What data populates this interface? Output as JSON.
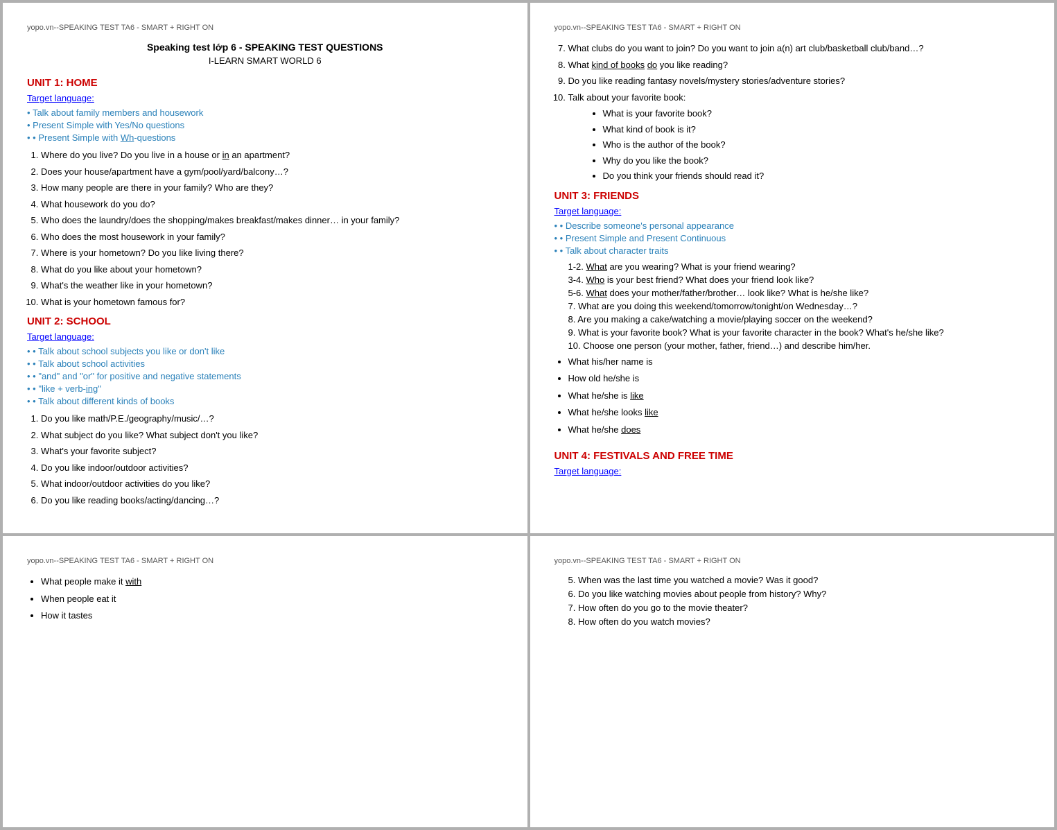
{
  "watermark": "yopo.vn--SPEAKING TEST TA6 - SMART + RIGHT ON",
  "panel_top_left": {
    "doc_title": "Speaking test lớp 6  -  SPEAKING TEST QUESTIONS",
    "doc_subtitle": "I-LEARN SMART WORLD 6",
    "unit1": {
      "heading": "UNIT 1: HOME",
      "target_lang_label": "Target language:",
      "bullets": [
        "Talk about family members and housework",
        "Present Simple with Yes/No questions",
        "Present Simple with Wh-questions"
      ],
      "questions": [
        "Where do you live? Do you live in a house or in an apartment?",
        "Does your house/apartment have a gym/pool/yard/balcony…?",
        "How many people are there in your family? Who are they?",
        "What housework do you do?",
        "Who does the laundry/does the shopping/makes breakfast/makes dinner… in your family?",
        "Who does the most housework in your family?",
        "Where is your hometown? Do you like living there?",
        "What do you like about your hometown?",
        "What's the weather like in your hometown?",
        "What is your hometown famous for?"
      ]
    },
    "unit2": {
      "heading": "UNIT 2: SCHOOL",
      "target_lang_label": "Target language:",
      "bullets": [
        "Talk about school subjects you like or don't like",
        "Talk about school activities",
        "\"and\" and \"or\" for positive and negative statements",
        "\"like + verb-ing\"",
        "Talk about different kinds of books"
      ],
      "questions": [
        "Do you like math/P.E./geography/music/…?",
        "What subject do you like? What subject don't you like?",
        "What's your favorite subject?",
        "Do you like indoor/outdoor activities?",
        "What indoor/outdoor activities do you like?",
        "Do you like reading books/acting/dancing…?"
      ]
    }
  },
  "panel_top_right": {
    "watermark": "yopo.vn--SPEAKING TEST TA6 - SMART + RIGHT ON",
    "continued_questions": [
      "What clubs do you want to join? Do you want to join a(n) art club/basketball club/band…?",
      "What kind of books do you like reading?",
      "Do you like reading fantasy novels/mystery stories/adventure stories?",
      "Talk about your favorite book:"
    ],
    "fav_book_bullets": [
      "What is your favorite book?",
      "What kind of book is it?",
      "Who is the author of the book?",
      "Why do you like the book?",
      "Do you think your friends should read it?"
    ],
    "unit3": {
      "heading": "UNIT 3: FRIENDS",
      "target_lang_label": "Target language:",
      "bullets": [
        "Describe someone's personal appearance",
        "Present Simple and Present Continuous",
        "Talk about character traits"
      ],
      "questions": [
        "1-2. What are you wearing? What is your friend wearing?",
        "3-4. Who is your best friend? What does your friend look like?",
        "5-6. What does your mother/father/brother… look like? What is he/she like?",
        "7. What are you doing this weekend/tomorrow/tonight/on Wednesday…?",
        "8. Are you making a cake/watching a movie/playing soccer on the weekend?",
        "9. What is your favorite book? What is your favorite character in the book? What's he/she like?",
        "10. Choose one person (your mother, father, friend…) and describe him/her."
      ],
      "person_bullets": [
        "What his/her name is",
        "How old he/she is",
        "What he/she is like",
        "What he/she looks like",
        "What he/she does"
      ]
    },
    "unit4": {
      "heading": "UNIT 4: FESTIVALS AND FREE TIME",
      "target_lang_label": "Target language:"
    }
  },
  "panel_bottom_left": {
    "watermark": "yopo.vn--SPEAKING TEST TA6 - SMART + RIGHT ON",
    "bullets": [
      "What people make it with",
      "When people eat it",
      "How it tastes"
    ]
  },
  "panel_bottom_right": {
    "watermark": "yopo.vn--SPEAKING TEST TA6 - SMART + RIGHT ON",
    "questions": [
      "5. When was the last time you watched a movie? Was it good?",
      "6. Do you like watching movies about people from history? Why?",
      "7. How often do you go to the movie theater?",
      "8. How often do you watch movies?"
    ]
  }
}
